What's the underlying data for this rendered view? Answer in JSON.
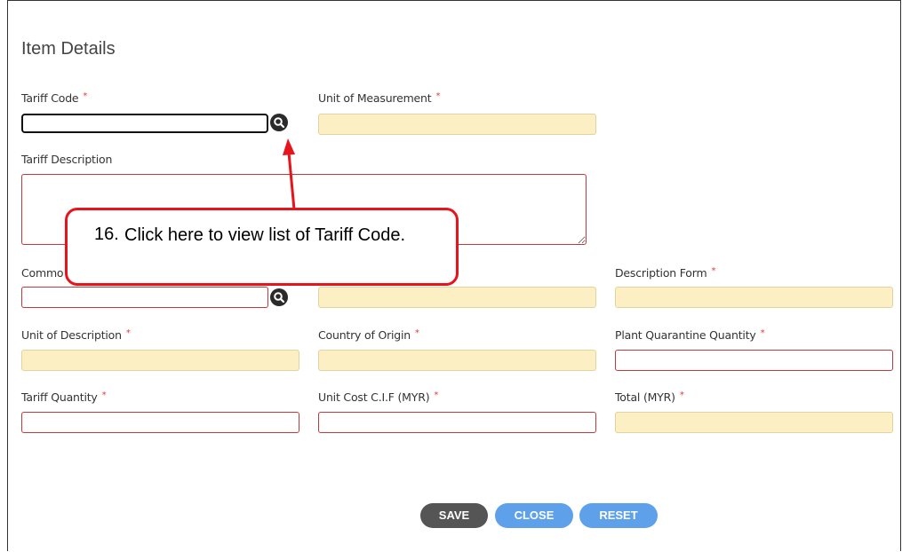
{
  "header": {
    "title": "Item Details"
  },
  "required_marker": "*",
  "fields": {
    "tariff_code": {
      "label": "Tariff Code",
      "value": ""
    },
    "unit_of_measurement": {
      "label": "Unit of Measurement",
      "value": ""
    },
    "tariff_description": {
      "label": "Tariff Description",
      "value": ""
    },
    "commodity": {
      "label": "Commo",
      "value": ""
    },
    "middle_row3": {
      "value": ""
    },
    "description_form": {
      "label": "Description Form",
      "value": ""
    },
    "unit_of_description": {
      "label": "Unit of Description",
      "value": ""
    },
    "country_of_origin": {
      "label": "Country of Origin",
      "value": ""
    },
    "plant_quarantine_quantity": {
      "label": "Plant Quarantine Quantity",
      "value": ""
    },
    "tariff_quantity": {
      "label": "Tariff Quantity",
      "value": ""
    },
    "unit_cost_cif": {
      "label": "Unit Cost C.I.F (MYR)",
      "value": ""
    },
    "total": {
      "label": "Total (MYR)",
      "value": ""
    }
  },
  "buttons": {
    "save": "SAVE",
    "close": "CLOSE",
    "reset": "RESET"
  },
  "callout": {
    "number": "16.",
    "text": "Click here to view list of Tariff Code."
  },
  "icons": {
    "tariff_lookup": "search-icon",
    "commodity_lookup": "search-icon"
  },
  "colors": {
    "readonly_fill": "#fbefc3",
    "required_border": "#c0393b",
    "callout_border": "#e8141b",
    "close_reset": "#5ea0ea",
    "save": "#555555"
  }
}
